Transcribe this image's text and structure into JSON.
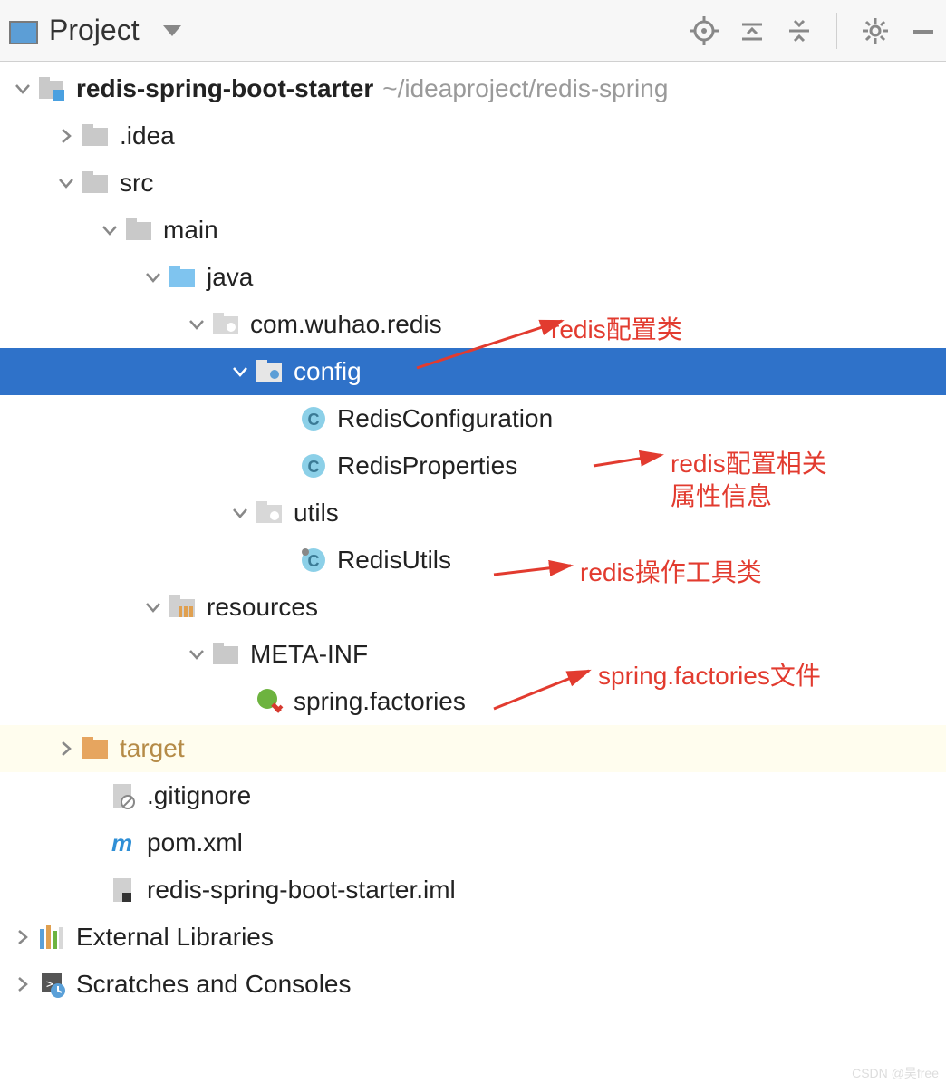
{
  "toolbar": {
    "project_label": "Project"
  },
  "tree": {
    "root": {
      "name": "redis-spring-boot-starter",
      "path": "~/ideaproject/redis-spring"
    },
    "idea": ".idea",
    "src": "src",
    "main": "main",
    "java": "java",
    "package": "com.wuhao.redis",
    "config": "config",
    "redis_configuration": "RedisConfiguration",
    "redis_properties": "RedisProperties",
    "utils": "utils",
    "redis_utils": "RedisUtils",
    "resources": "resources",
    "meta_inf": "META-INF",
    "spring_factories": "spring.factories",
    "target": "target",
    "gitignore": ".gitignore",
    "pom": "pom.xml",
    "iml": "redis-spring-boot-starter.iml",
    "external_libraries": "External Libraries",
    "scratches": "Scratches and Consoles"
  },
  "annotations": {
    "config_class": "redis配置类",
    "properties1": "redis配置相关",
    "properties2": "属性信息",
    "utils": "redis操作工具类",
    "factories": "spring.factories文件"
  },
  "watermark": "CSDN @吴free"
}
